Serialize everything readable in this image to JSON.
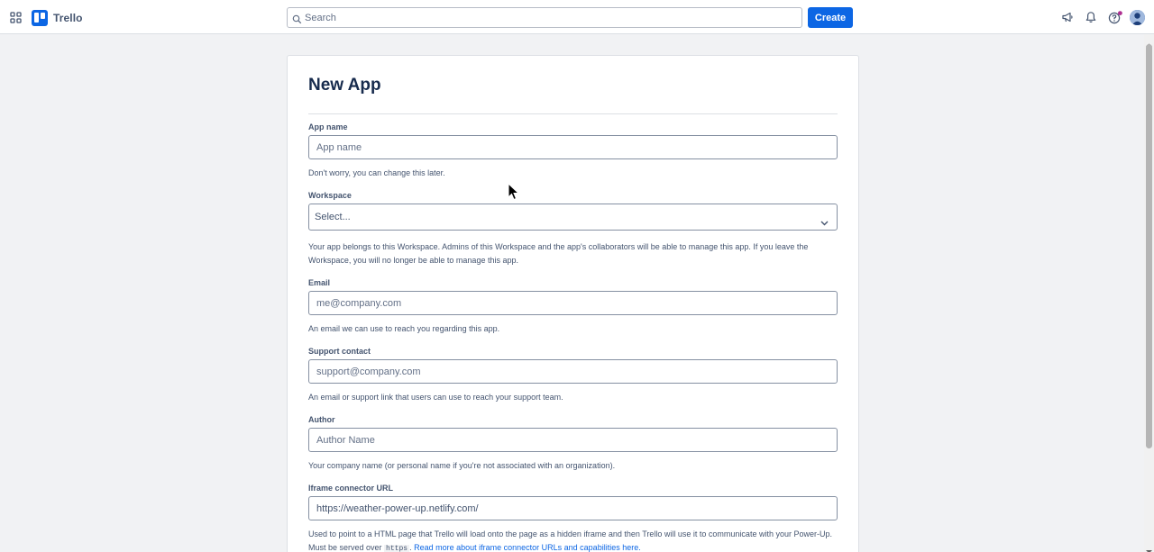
{
  "topbar": {
    "app_name": "Trello",
    "search_placeholder": "Search",
    "create_label": "Create",
    "icons": [
      "apps-grid-icon",
      "megaphone-icon",
      "bell-icon",
      "help-icon",
      "avatar"
    ],
    "accent": "#0c66e4"
  },
  "form": {
    "title": "New App",
    "app_name": {
      "label": "App name",
      "placeholder": "App name",
      "value": "",
      "help": "Don't worry, you can change this later."
    },
    "workspace": {
      "label": "Workspace",
      "selected": "Select...",
      "help": "Your app belongs to this Workspace. Admins of this Workspace and the app's collaborators will be able to manage this app. If you leave the Workspace, you will no longer be able to manage this app."
    },
    "email": {
      "label": "Email",
      "placeholder": "me@company.com",
      "value": "",
      "help": "An email we can use to reach you regarding this app."
    },
    "support": {
      "label": "Support contact",
      "placeholder": "support@company.com",
      "value": "",
      "help": "An email or support link that users can use to reach your support team."
    },
    "author": {
      "label": "Author",
      "placeholder": "Author Name",
      "value": "",
      "help": "Your company name (or personal name if you're not associated with an organization)."
    },
    "iframe": {
      "label": "Iframe connector URL",
      "placeholder": "",
      "value": "https://weather-power-up.netlify.com/",
      "help_before": "Used to point to a HTML page that Trello will load onto the page as a hidden iframe and then Trello will use it to communicate with your Power-Up. Must be served over ",
      "help_code": "https",
      "help_middle": ". ",
      "help_link": "Read more about iframe connector URLs and capabilities here."
    }
  }
}
